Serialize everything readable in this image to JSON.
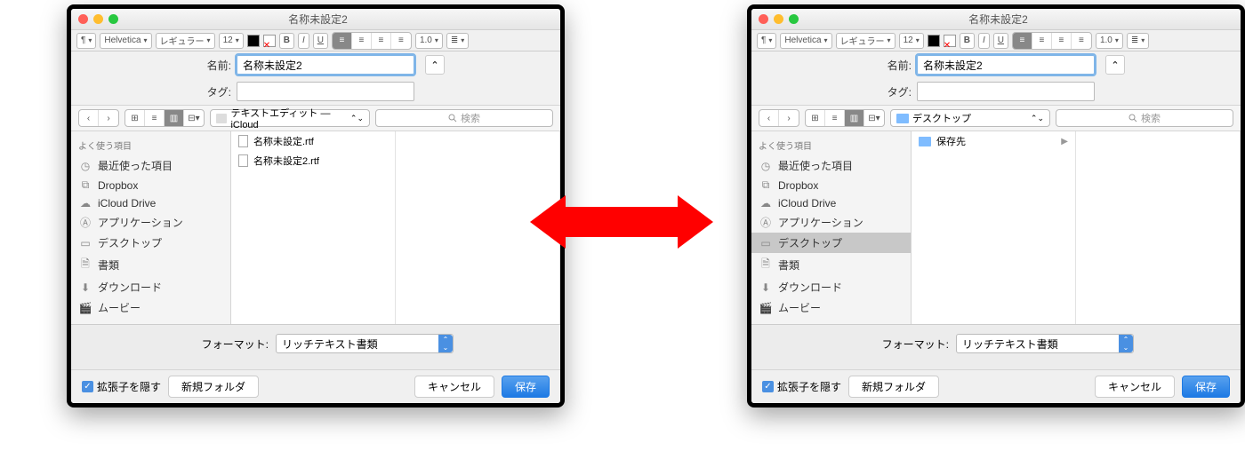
{
  "shared": {
    "window_title": "名称未設定2",
    "toolbar": {
      "font_family": "Helvetica",
      "font_style": "レギュラー",
      "font_size": "12",
      "line_spacing": "1.0"
    },
    "name_label": "名前:",
    "name_value": "名称未設定2",
    "tag_label": "タグ:",
    "tag_value": "",
    "search_placeholder": "検索",
    "sidebar_header": "よく使う項目",
    "sidebar": [
      {
        "icon": "clock",
        "label": "最近使った項目"
      },
      {
        "icon": "dropbox",
        "label": "Dropbox"
      },
      {
        "icon": "cloud",
        "label": "iCloud Drive"
      },
      {
        "icon": "app",
        "label": "アプリケーション"
      },
      {
        "icon": "desktop",
        "label": "デスクトップ"
      },
      {
        "icon": "doc",
        "label": "書類"
      },
      {
        "icon": "download",
        "label": "ダウンロード"
      },
      {
        "icon": "movie",
        "label": "ムービー"
      }
    ],
    "format_label": "フォーマット:",
    "format_value": "リッチテキスト書類",
    "hide_ext_label": "拡張子を隠す",
    "new_folder": "新規フォルダ",
    "cancel": "キャンセル",
    "save": "保存"
  },
  "left": {
    "location": "テキストエディット — iCloud",
    "selected_sidebar": null,
    "files": [
      {
        "type": "doc",
        "name": "名称未設定.rtf"
      },
      {
        "type": "doc",
        "name": "名称未設定2.rtf"
      }
    ]
  },
  "right": {
    "location": "デスクトップ",
    "selected_sidebar": "デスクトップ",
    "files": [
      {
        "type": "folder",
        "name": "保存先",
        "has_children": true
      }
    ]
  }
}
